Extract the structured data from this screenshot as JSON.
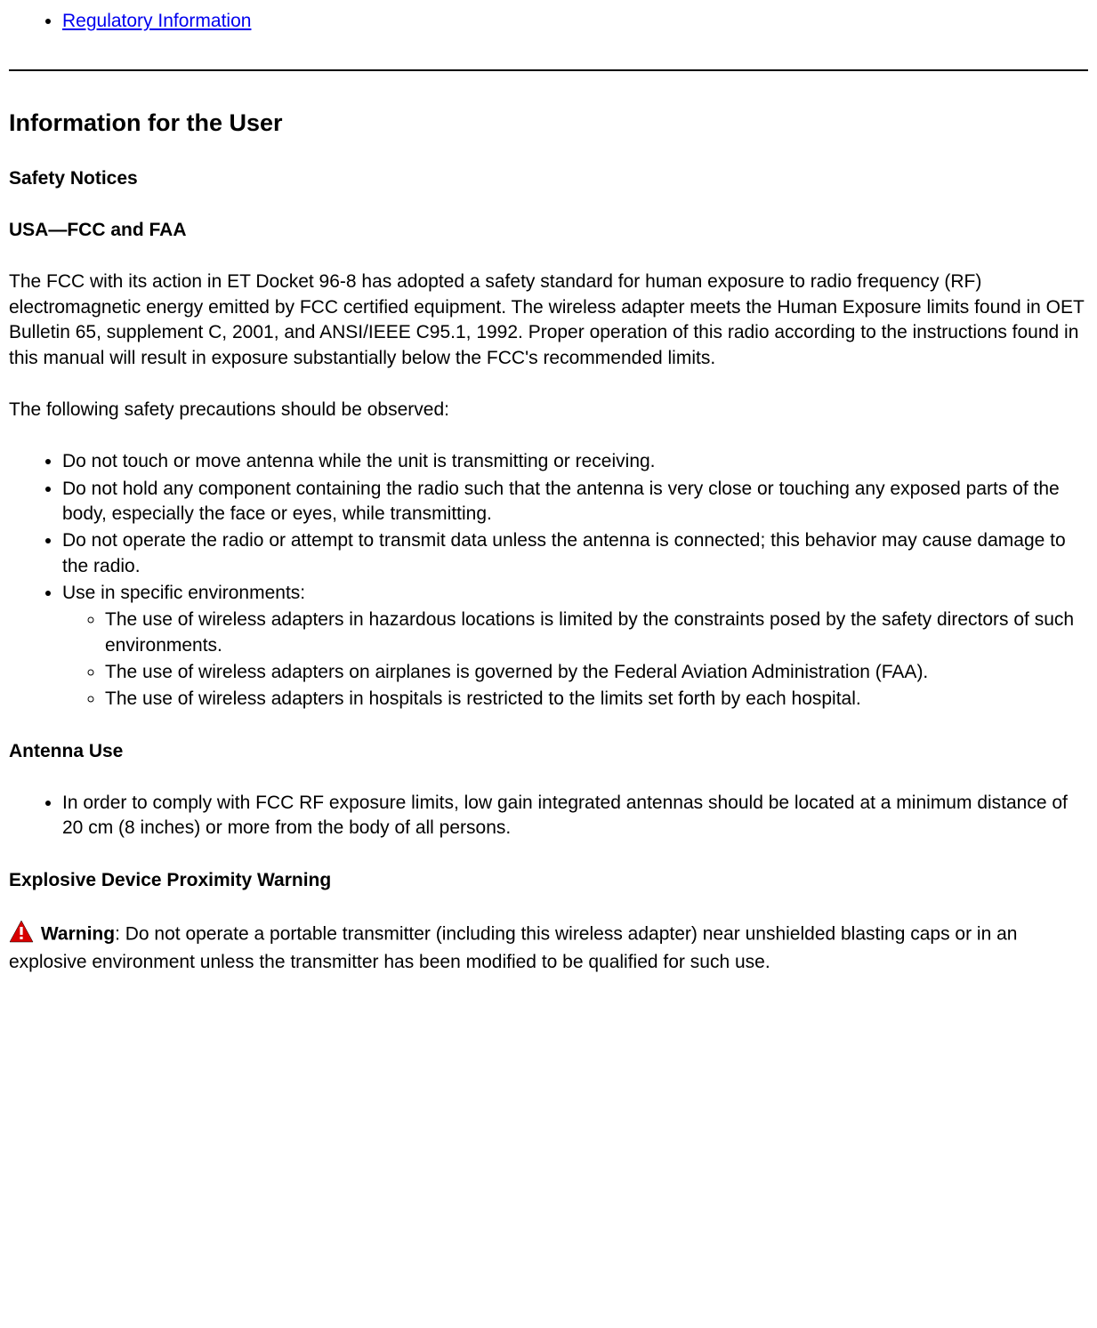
{
  "top_link": {
    "label": "Regulatory Information"
  },
  "headings": {
    "info_for_user": "Information for the User",
    "safety_notices": "Safety Notices",
    "usa_fcc_faa": "USA—FCC and FAA",
    "antenna_use": "Antenna Use",
    "explosive_warning": "Explosive Device Proximity Warning"
  },
  "paragraphs": {
    "fcc_intro": "The FCC with its action in ET Docket 96-8 has adopted a safety standard for human exposure to radio frequency (RF) electromagnetic energy emitted by FCC certified equipment. The wireless adapter meets the Human Exposure limits found in OET Bulletin 65, supplement C, 2001, and ANSI/IEEE C95.1, 1992. Proper operation of this radio according to the instructions found in this manual will result in exposure substantially below the FCC's recommended limits.",
    "precautions_intro": "The following safety precautions should be observed:"
  },
  "precaution_bullets": {
    "b1": "Do not touch or move antenna while the unit is transmitting or receiving.",
    "b2": "Do not hold any component containing the radio such that the antenna is very close or touching any exposed parts of the body, especially the face or eyes, while transmitting.",
    "b3": "Do not operate the radio or attempt to transmit data unless the antenna is connected; this behavior may cause damage to the radio.",
    "b4": "Use in specific environments:",
    "b4_sub1": "The use of wireless adapters in hazardous locations is limited by the constraints posed by the safety directors of such environments.",
    "b4_sub2": "The use of wireless adapters on airplanes is governed by the Federal Aviation Administration (FAA).",
    "b4_sub3": "The use of wireless adapters in hospitals is restricted to the limits set forth by each hospital."
  },
  "antenna_bullets": {
    "a1": "In order to comply with FCC RF exposure limits, low gain integrated antennas should be located at a minimum distance of 20 cm (8 inches) or more from the body of all persons."
  },
  "warning": {
    "label": "Warning",
    "text": ": Do not operate a portable transmitter (including this wireless adapter) near unshielded blasting caps or in an explosive environment unless the transmitter has been modified to be qualified for such use."
  }
}
